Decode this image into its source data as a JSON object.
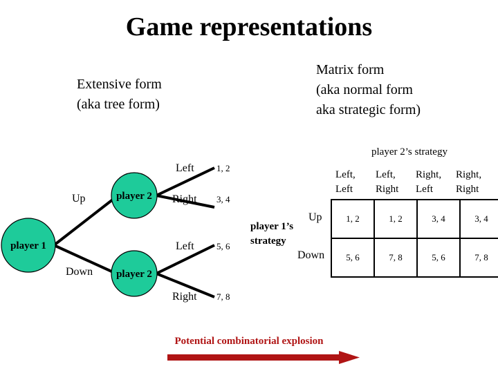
{
  "slide": {
    "title": "Game representations",
    "background_color": "#FFFFFF",
    "node_fill_color": "#1ECB9A",
    "accent_color": "#B01414"
  },
  "headings": {
    "extensive": "Extensive form\n(aka tree form)",
    "extensive_line1": "Extensive form",
    "extensive_line2": "(aka tree form)",
    "matrix_line1": "Matrix form",
    "matrix_line2": "(aka normal form",
    "matrix_line3": "aka strategic form)"
  },
  "tree": {
    "root_node_label": "player 1",
    "upper_node_label": "player 2",
    "lower_node_label": "player 2",
    "edges": {
      "up": "Up",
      "down": "Down",
      "upper_left": "Left",
      "upper_right": "Right",
      "lower_left": "Left",
      "lower_right": "Right"
    },
    "payoffs": {
      "up_left": "1, 2",
      "up_right": "3, 4",
      "down_left": "5, 6",
      "down_right": "7, 8"
    }
  },
  "matrix": {
    "col_axis_title": "player 2’s strategy",
    "row_axis_title": "player 1’s strategy",
    "row_axis_line1": "player 1’s",
    "row_axis_line2": "strategy",
    "column_headers": [
      {
        "line1": "Left,",
        "line2": "Left"
      },
      {
        "line1": "Left,",
        "line2": "Right"
      },
      {
        "line1": "Right,",
        "line2": "Left"
      },
      {
        "line1": "Right,",
        "line2": "Right"
      }
    ],
    "row_headers": [
      "Up",
      "Down"
    ],
    "cells": [
      [
        "1, 2",
        "1, 2",
        "3, 4",
        "3, 4"
      ],
      [
        "5, 6",
        "7, 8",
        "5, 6",
        "7, 8"
      ]
    ]
  },
  "caption": {
    "text": "Potential combinatorial explosion",
    "color": "#B01414"
  }
}
